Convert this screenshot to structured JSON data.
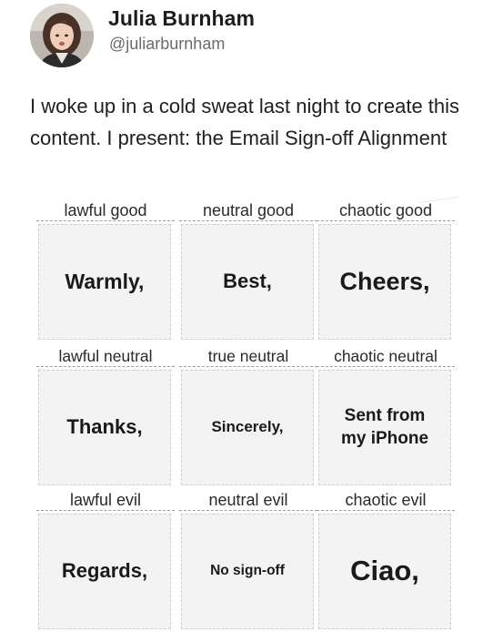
{
  "author": {
    "display_name": "Julia Burnham",
    "handle": "@juliarburnham",
    "avatar_icon": "profile-photo-avatar"
  },
  "tweet": {
    "text": "I woke up in a cold sweat last night to create this content. I present: the Email Sign-off Alignment"
  },
  "alignment_chart": {
    "rows": [
      {
        "cells": [
          {
            "label": "lawful good",
            "sign_off": "Warmly,"
          },
          {
            "label": "neutral good",
            "sign_off": "Best,"
          },
          {
            "label": "chaotic good",
            "sign_off": "Cheers,"
          }
        ]
      },
      {
        "cells": [
          {
            "label": "lawful neutral",
            "sign_off": "Thanks,"
          },
          {
            "label": "true neutral",
            "sign_off": "Sincerely,"
          },
          {
            "label": "chaotic neutral",
            "sign_off": "Sent from my iPhone"
          }
        ]
      },
      {
        "cells": [
          {
            "label": "lawful evil",
            "sign_off": "Regards,"
          },
          {
            "label": "neutral evil",
            "sign_off": "No sign-off"
          },
          {
            "label": "chaotic evil",
            "sign_off": "Ciao,"
          }
        ]
      }
    ]
  },
  "colors": {
    "text": "#1a1a1a",
    "handle": "#6b6b6b",
    "cell_background": "#f3f3f3",
    "page_background": "#ffffff"
  }
}
